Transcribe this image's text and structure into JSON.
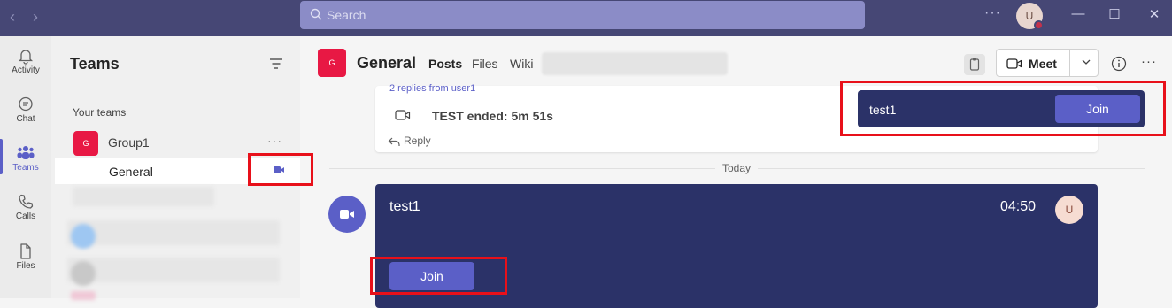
{
  "search": {
    "placeholder": "Search"
  },
  "user": {
    "initial": "U"
  },
  "rail": [
    {
      "label": "Activity"
    },
    {
      "label": "Chat"
    },
    {
      "label": "Teams"
    },
    {
      "label": "Calls"
    },
    {
      "label": "Files"
    }
  ],
  "panel": {
    "title": "Teams",
    "section": "Your teams",
    "team": {
      "name": "Group1",
      "initial": "G"
    },
    "channel": {
      "name": "General"
    }
  },
  "channel_header": {
    "initial": "G",
    "title": "General",
    "tabs": [
      "Posts",
      "Files",
      "Wiki"
    ],
    "meet_label": "Meet"
  },
  "previous_message": {
    "reply_count_text": "2 replies from user1",
    "event_text": "TEST ended: 5m 51s",
    "reply_label": "Reply"
  },
  "divider_label": "Today",
  "meeting_card": {
    "title": "test1",
    "time": "04:50",
    "avatar_initial": "U",
    "join_label": "Join"
  },
  "banner": {
    "title": "test1",
    "join_label": "Join"
  },
  "colors": {
    "titlebar": "#464775",
    "accent": "#5b5fc7",
    "meeting_card": "#2b3268",
    "highlight": "#e8101a",
    "team_avatar": "#e81844"
  }
}
